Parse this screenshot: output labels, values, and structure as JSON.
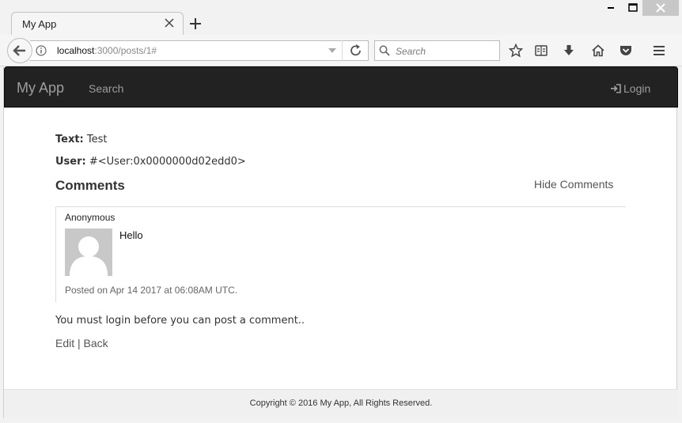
{
  "browser": {
    "tab_title": "My App",
    "url_host": "localhost",
    "url_rest": ":3000/posts/1#",
    "search_placeholder": "Search",
    "icons": [
      "back-arrow-icon",
      "info-icon",
      "dropdown-icon",
      "reload-icon",
      "search-icon",
      "bookmark-star-icon",
      "reading-list-icon",
      "download-icon",
      "home-icon",
      "pocket-icon",
      "menu-icon"
    ]
  },
  "app_nav": {
    "brand": "My App",
    "search_link": "Search",
    "login_link": "Login"
  },
  "post": {
    "text_label": "Text:",
    "text_value": "Test",
    "user_label": "User:",
    "user_value": "#<User:0x0000000d02edd0>"
  },
  "comments": {
    "heading": "Comments",
    "toggle_label": "Hide Comments",
    "items": [
      {
        "author": "Anonymous",
        "body": "Hello",
        "posted": "Posted on Apr 14 2017 at 06:08AM UTC."
      }
    ]
  },
  "login_note": "You must login before you can post a comment..",
  "actions": {
    "edit": "Edit",
    "separator": "|",
    "back": "Back"
  },
  "footer": {
    "copyright": "Copyright © 2016 My App, All Rights Reserved."
  },
  "colors": {
    "navbar_bg": "#222222",
    "navbar_text": "#9d9d9d",
    "footer_bg": "#f0f0f0"
  }
}
